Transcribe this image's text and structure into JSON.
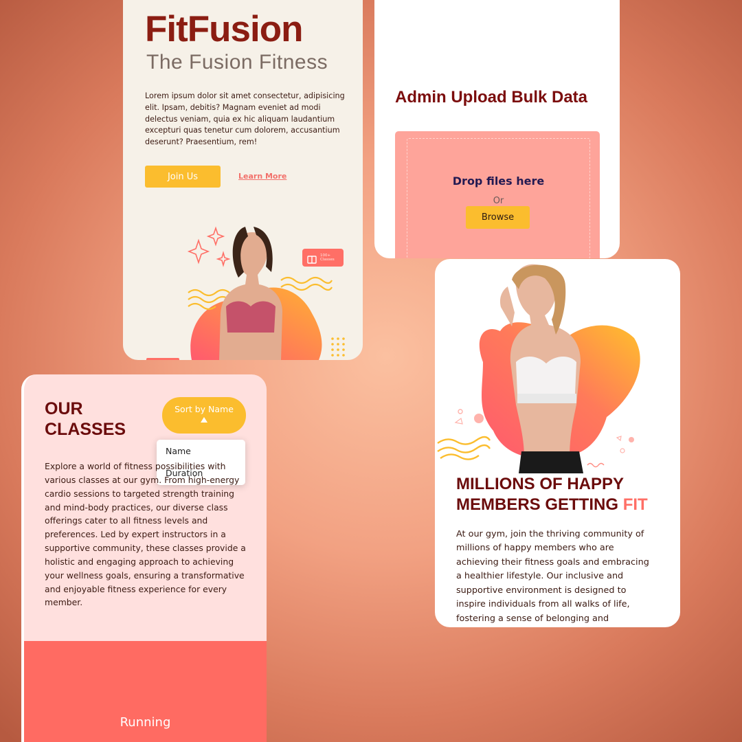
{
  "hero": {
    "brand": "FitFusion",
    "tagline": "The Fusion Fitness",
    "description": "Lorem ipsum dolor sit amet consectetur, adipisicing elit. Ipsam, debitis? Magnam eveniet ad modi delectus veniam, quia ex hic aliquam laudantium excepturi quas tenetur cum dolorem, accusantium deserunt? Praesentium, rem!",
    "join_label": "Join Us",
    "learn_label": "Learn More",
    "badge_text": "100+ Classes",
    "badge_icon": "book-icon"
  },
  "upload": {
    "title": "Admin Upload Bulk Data",
    "drop_text": "Drop files here",
    "or_text": "Or",
    "browse_label": "Browse"
  },
  "classes": {
    "title": "OUR CLASSES",
    "sort_label": "Sort by Name",
    "sort_options": [
      "Name",
      "Duration"
    ],
    "description": "Explore a world of fitness possibilities with various classes at our gym. From high-energy cardio sessions to targeted strength training and mind-body practices, our diverse class offerings cater to all fitness levels and preferences. Led by expert instructors in a supportive community, these classes provide a holistic and engaging approach to achieving your wellness goals, ensuring a transformative and enjoyable fitness experience for every member.",
    "first_class": "Running"
  },
  "members": {
    "title_main": "MILLIONS OF HAPPY MEMBERS GETTING",
    "title_accent": "FIT",
    "description": "At our gym, join the thriving community of millions of happy members who are achieving their fitness goals and embracing a healthier lifestyle. Our inclusive and supportive environment is designed to inspire individuals from all walks of life, fostering a sense of belonging and encouragement. With a diverse"
  },
  "colors": {
    "brand_red": "#8b1d12",
    "accent_coral": "#ff6f66",
    "accent_yellow": "#fbbd2e",
    "cream": "#f6f1e8",
    "pink_light": "#ffe0de"
  }
}
